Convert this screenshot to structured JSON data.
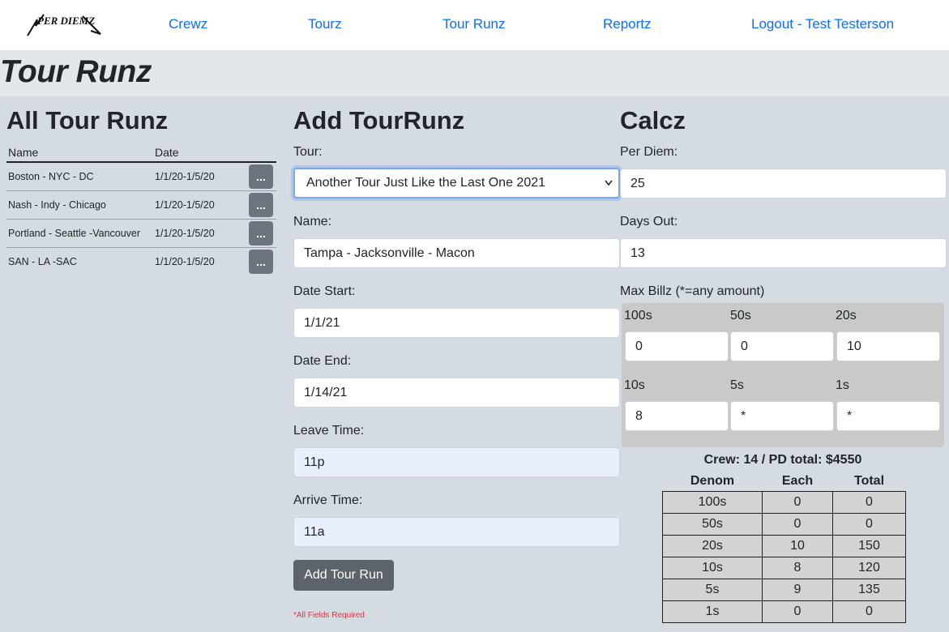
{
  "nav": {
    "logo_text": "PER DIEMZ",
    "links": [
      "Crewz",
      "Tourz",
      "Tour Runz",
      "Reportz",
      "Logout - Test Testerson"
    ],
    "link_color": "#0d6efd"
  },
  "page_title": "Tour Runz",
  "all_runs": {
    "heading": "All Tour Runz",
    "columns": [
      "Name",
      "Date"
    ],
    "rows": [
      {
        "name": "Boston - NYC - DC",
        "date": "1/1/20-1/5/20",
        "action": "..."
      },
      {
        "name": "Nash - Indy - Chicago",
        "date": "1/1/20-1/5/20",
        "action": "..."
      },
      {
        "name": "Portland - Seattle -Vancouver",
        "date": "1/1/20-1/5/20",
        "action": "..."
      },
      {
        "name": "SAN - LA -SAC",
        "date": "1/1/20-1/5/20",
        "action": "..."
      }
    ]
  },
  "add_form": {
    "heading": "Add TourRunz",
    "tour_label": "Tour:",
    "tour_value": "Another Tour Just Like the Last One 2021",
    "name_label": "Name:",
    "name_value": "Tampa - Jacksonville - Macon",
    "date_start_label": "Date Start:",
    "date_start_value": "1/1/21",
    "date_end_label": "Date End:",
    "date_end_value": "1/14/21",
    "leave_label": "Leave Time:",
    "leave_value": "11p",
    "arrive_label": "Arrive Time:",
    "arrive_value": "11a",
    "submit_label": "Add Tour Run",
    "required_note": "*All Fields Required"
  },
  "calcz": {
    "heading": "Calcz",
    "per_diem_label": "Per Diem:",
    "per_diem_value": "25",
    "days_out_label": "Days Out:",
    "days_out_value": "13",
    "max_billz_label": "Max Billz (*=any amount)",
    "bills": [
      {
        "label": "100s",
        "value": "0"
      },
      {
        "label": "50s",
        "value": "0"
      },
      {
        "label": "20s",
        "value": "10"
      },
      {
        "label": "10s",
        "value": "8"
      },
      {
        "label": "5s",
        "value": "*"
      },
      {
        "label": "1s",
        "value": "*"
      }
    ],
    "summary": "Crew: 14 / PD total: $4550",
    "table_headers": [
      "Denom",
      "Each",
      "Total"
    ],
    "table_rows": [
      [
        "100s",
        "0",
        "0"
      ],
      [
        "50s",
        "0",
        "0"
      ],
      [
        "20s",
        "10",
        "150"
      ],
      [
        "10s",
        "8",
        "120"
      ],
      [
        "5s",
        "9",
        "135"
      ],
      [
        "1s",
        "0",
        "0"
      ]
    ]
  },
  "colors": {
    "page_bg": "#d4dbe2",
    "button_bg": "#6c757d",
    "required_red": "#dc3545"
  }
}
